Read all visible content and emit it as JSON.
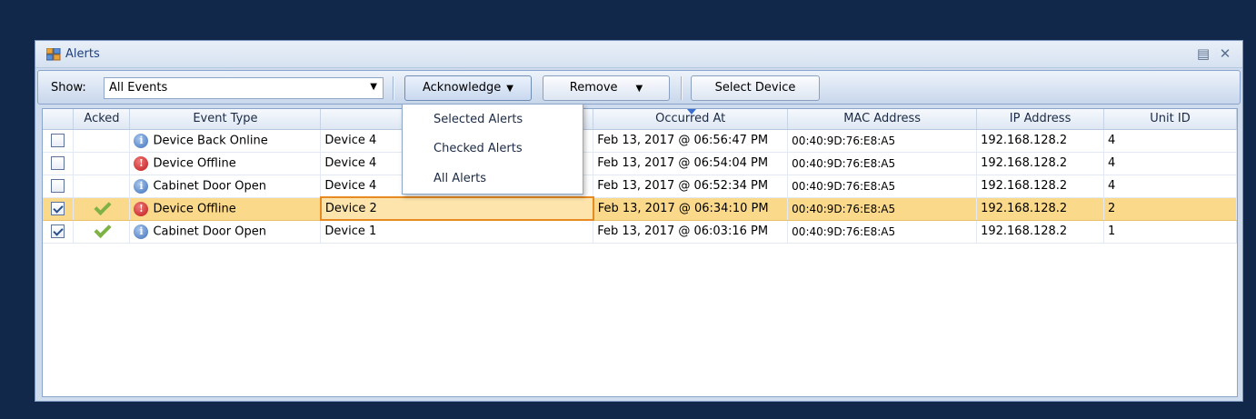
{
  "window": {
    "title": "Alerts"
  },
  "toolbar": {
    "show_label": "Show:",
    "show_value": "All Events",
    "acknowledge_label": "Acknowledge",
    "remove_label": "Remove",
    "select_device_label": "Select Device"
  },
  "dropdown": {
    "items": [
      "Selected Alerts",
      "Checked Alerts",
      "All Alerts"
    ]
  },
  "table": {
    "columns": [
      "",
      "Acked",
      "Event Type",
      "",
      "Occurred At",
      "MAC Address",
      "IP Address",
      "Unit ID"
    ],
    "rows": [
      {
        "checked": false,
        "acked": false,
        "icon": "info-icon",
        "event": "Device Back Online",
        "device": "Device 4",
        "occurred": "Feb 13, 2017 @ 06:56:47 PM",
        "mac": "00:40:9D:76:E8:A5",
        "ip": "192.168.128.2",
        "unit": "4"
      },
      {
        "checked": false,
        "acked": false,
        "icon": "error-icon",
        "event": "Device Offline",
        "device": "Device 4",
        "occurred": "Feb 13, 2017 @ 06:54:04 PM",
        "mac": "00:40:9D:76:E8:A5",
        "ip": "192.168.128.2",
        "unit": "4"
      },
      {
        "checked": false,
        "acked": false,
        "icon": "info-icon",
        "event": "Cabinet Door Open",
        "device": "Device 4",
        "occurred": "Feb 13, 2017 @ 06:52:34 PM",
        "mac": "00:40:9D:76:E8:A5",
        "ip": "192.168.128.2",
        "unit": "4"
      },
      {
        "checked": true,
        "acked": true,
        "icon": "error-icon",
        "event": "Device Offline",
        "device": "Device 2",
        "occurred": "Feb 13, 2017 @ 06:34:10 PM",
        "mac": "00:40:9D:76:E8:A5",
        "ip": "192.168.128.2",
        "unit": "2"
      },
      {
        "checked": true,
        "acked": true,
        "icon": "info-icon",
        "event": "Cabinet Door Open",
        "device": "Device 1",
        "occurred": "Feb 13, 2017 @ 06:03:16 PM",
        "mac": "00:40:9D:76:E8:A5",
        "ip": "192.168.128.2",
        "unit": "1"
      }
    ],
    "selected_row": 3
  },
  "icons": {
    "info_glyph": "i",
    "error_glyph": "!"
  },
  "colors": {
    "background": "#12284a",
    "selection": "#fbd98a",
    "focus_border": "#e88a22",
    "info": "#3b6fb8",
    "error": "#c01818",
    "ack_check": "#7fb244"
  }
}
